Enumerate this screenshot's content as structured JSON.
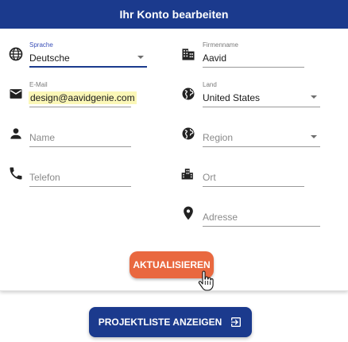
{
  "header": {
    "title": "Ihr Konto bearbeiten"
  },
  "form": {
    "language": {
      "label": "Sprache",
      "value": "Deutsche"
    },
    "company": {
      "label": "Firmenname",
      "value": "Aavid"
    },
    "email": {
      "label": "E-Mail",
      "value": "design@aavidgenie.com"
    },
    "country": {
      "label": "Land",
      "value": "United States"
    },
    "name": {
      "placeholder": "Name"
    },
    "region": {
      "placeholder": "Region"
    },
    "phone": {
      "placeholder": "Telefon"
    },
    "city": {
      "placeholder": "Ort"
    },
    "address": {
      "placeholder": "Adresse"
    }
  },
  "buttons": {
    "update": "AKTUALISIEREN",
    "project_list": "PROJEKTLISTE ANZEIGEN"
  },
  "colors": {
    "primary": "#1b3a8d",
    "accent": "#e9683f",
    "highlight": "#fbf7b7"
  },
  "icons": {
    "language": "globe-icon",
    "company": "building-icon",
    "email": "mail-icon",
    "country": "globe-icon",
    "name": "person-icon",
    "region": "globe-icon",
    "phone": "phone-icon",
    "city": "city-icon",
    "address": "location-pin-icon",
    "project_list": "exit-icon"
  }
}
